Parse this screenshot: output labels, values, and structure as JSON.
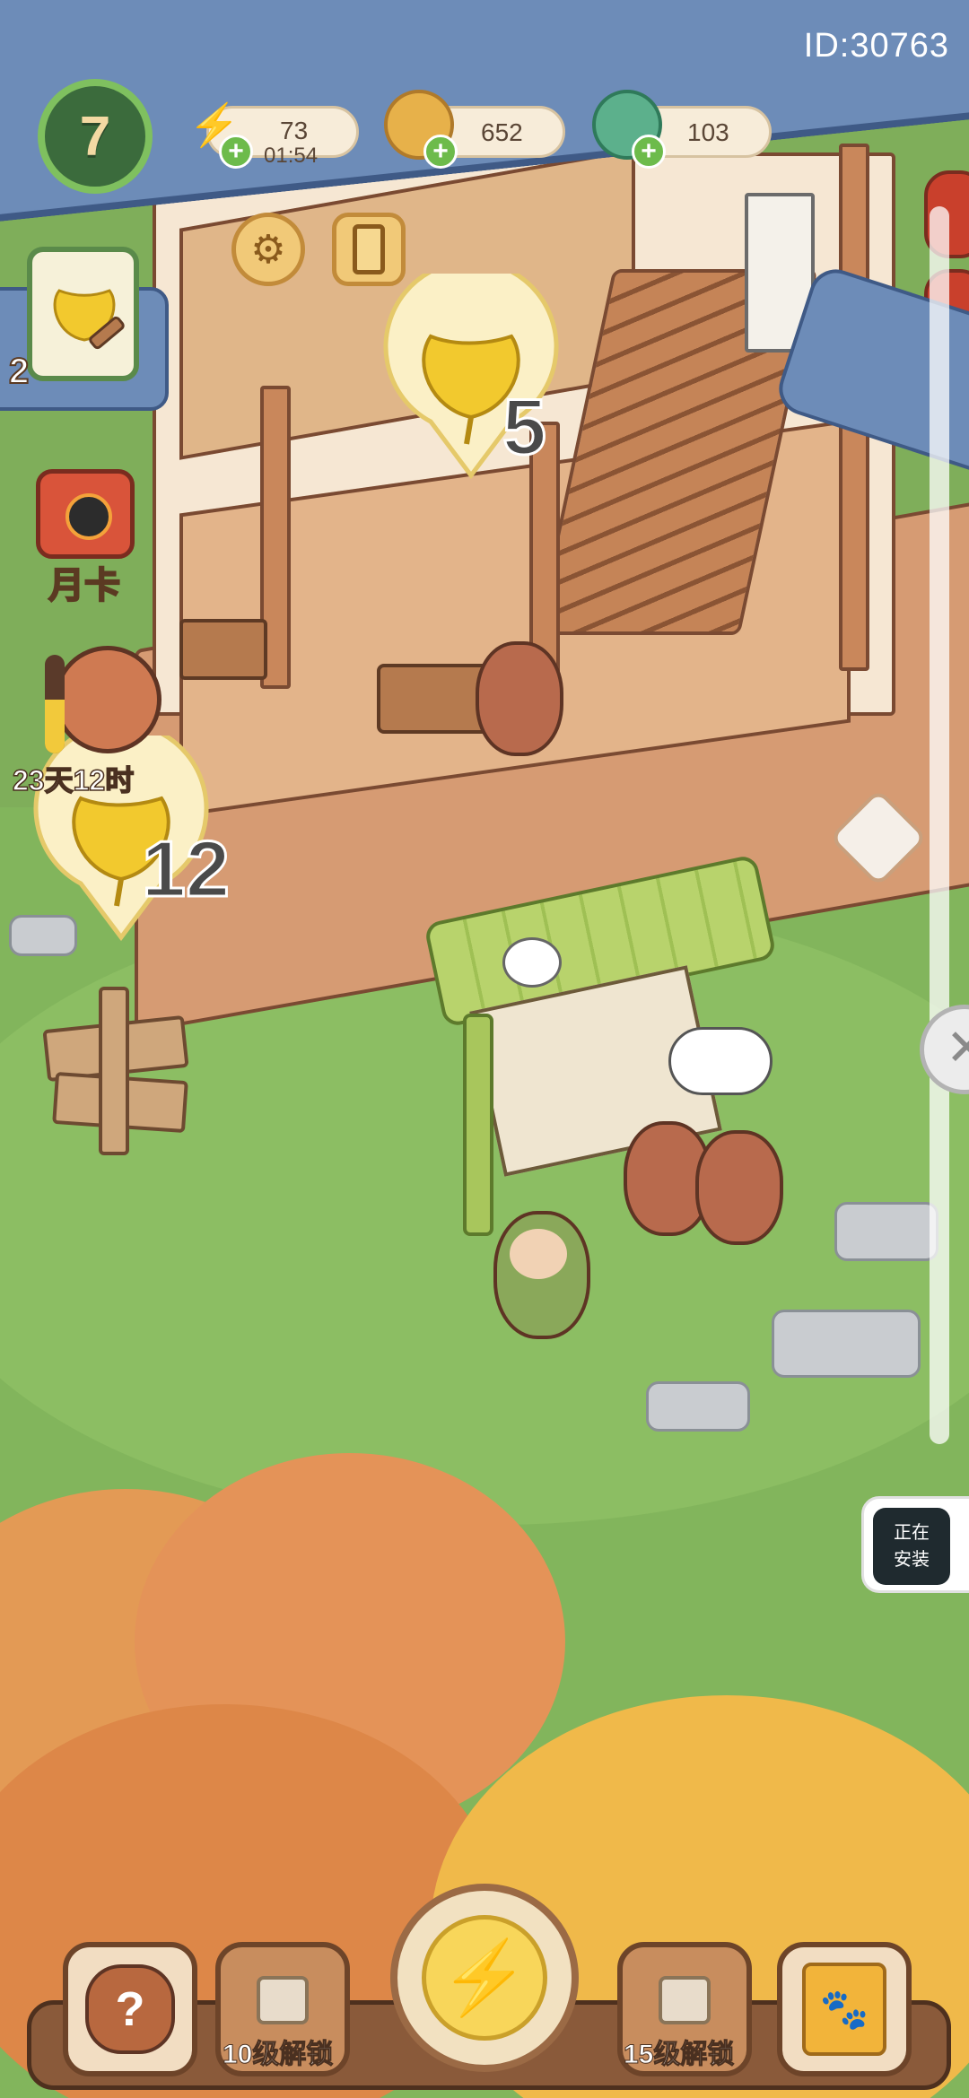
{
  "hud": {
    "level": "7",
    "game_id": "ID:30763",
    "energy": {
      "value": "73",
      "timer": "01:54",
      "icon": "lightning-icon"
    },
    "coins": {
      "value": "652",
      "icon": "coin-icon"
    },
    "jade": {
      "value": "103",
      "icon": "jade-leaf-icon"
    }
  },
  "top_tools": {
    "settings_icon": "gear-icon",
    "book_icon": "book-icon"
  },
  "pins": {
    "loft_ginkgo": {
      "count": "5",
      "icon": "ginkgo-leaf-icon"
    },
    "yard_ginkgo": {
      "count": "12",
      "icon": "ginkgo-leaf-icon"
    }
  },
  "side": {
    "build_task": {
      "count": "2",
      "icon": "ginkgo-hammer-icon"
    },
    "monthly_card": {
      "label": "月卡",
      "icon": "monthly-card-icon"
    },
    "event": {
      "time_left": "23天12时",
      "progress": 0.55,
      "icon": "red-panda-event-icon"
    }
  },
  "install_chip": {
    "line1": "正在",
    "line2": "安装"
  },
  "bottom_bar": {
    "help_icon": "cat-question-icon",
    "lock1_label": "10级解锁",
    "center_icon": "lightning-icon",
    "lock2_label": "15级解锁",
    "paw_icon": "paw-book-icon"
  },
  "colors": {
    "accent_green": "#6dbb4b",
    "gold": "#f1c978",
    "roof_blue": "#6d8cb8"
  }
}
